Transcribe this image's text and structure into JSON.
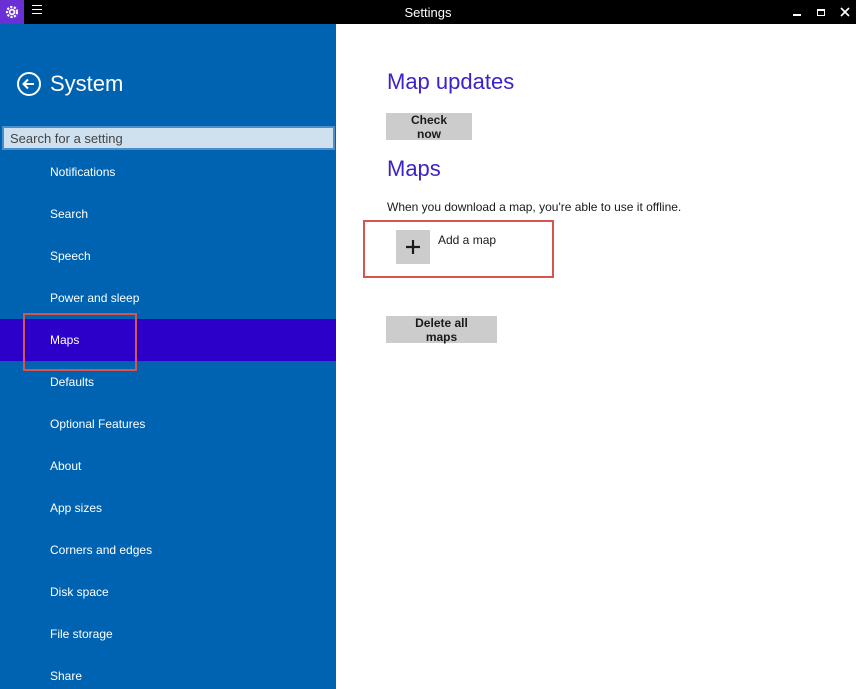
{
  "window": {
    "title": "Settings",
    "app_icon": "gear-icon",
    "menu_icon": "hamburger-icon",
    "controls": [
      "minimize-icon",
      "maximize-icon",
      "close-icon"
    ]
  },
  "sidebar": {
    "back_icon": "back-arrow-icon",
    "title": "System",
    "search_placeholder": "Search for a setting",
    "items": [
      {
        "label": "Notifications"
      },
      {
        "label": "Search"
      },
      {
        "label": "Speech"
      },
      {
        "label": "Power and sleep"
      },
      {
        "label": "Maps",
        "selected": true
      },
      {
        "label": "Defaults"
      },
      {
        "label": "Optional Features"
      },
      {
        "label": "About"
      },
      {
        "label": "App sizes"
      },
      {
        "label": "Corners and edges"
      },
      {
        "label": "Disk space"
      },
      {
        "label": "File storage"
      },
      {
        "label": "Share"
      }
    ]
  },
  "main": {
    "map_updates_heading": "Map updates",
    "check_now_label": "Check now",
    "maps_heading": "Maps",
    "maps_description": "When you download a map, you're able to use it offline.",
    "add_map_label": "Add a map",
    "add_map_icon": "plus-icon",
    "delete_all_label": "Delete all maps"
  },
  "colors": {
    "sidebar_bg": "#0063b1",
    "selected_bg": "#2c00c9",
    "heading": "#3a23c8",
    "highlight_border": "#d9534f",
    "button_bg": "#cccccc"
  }
}
